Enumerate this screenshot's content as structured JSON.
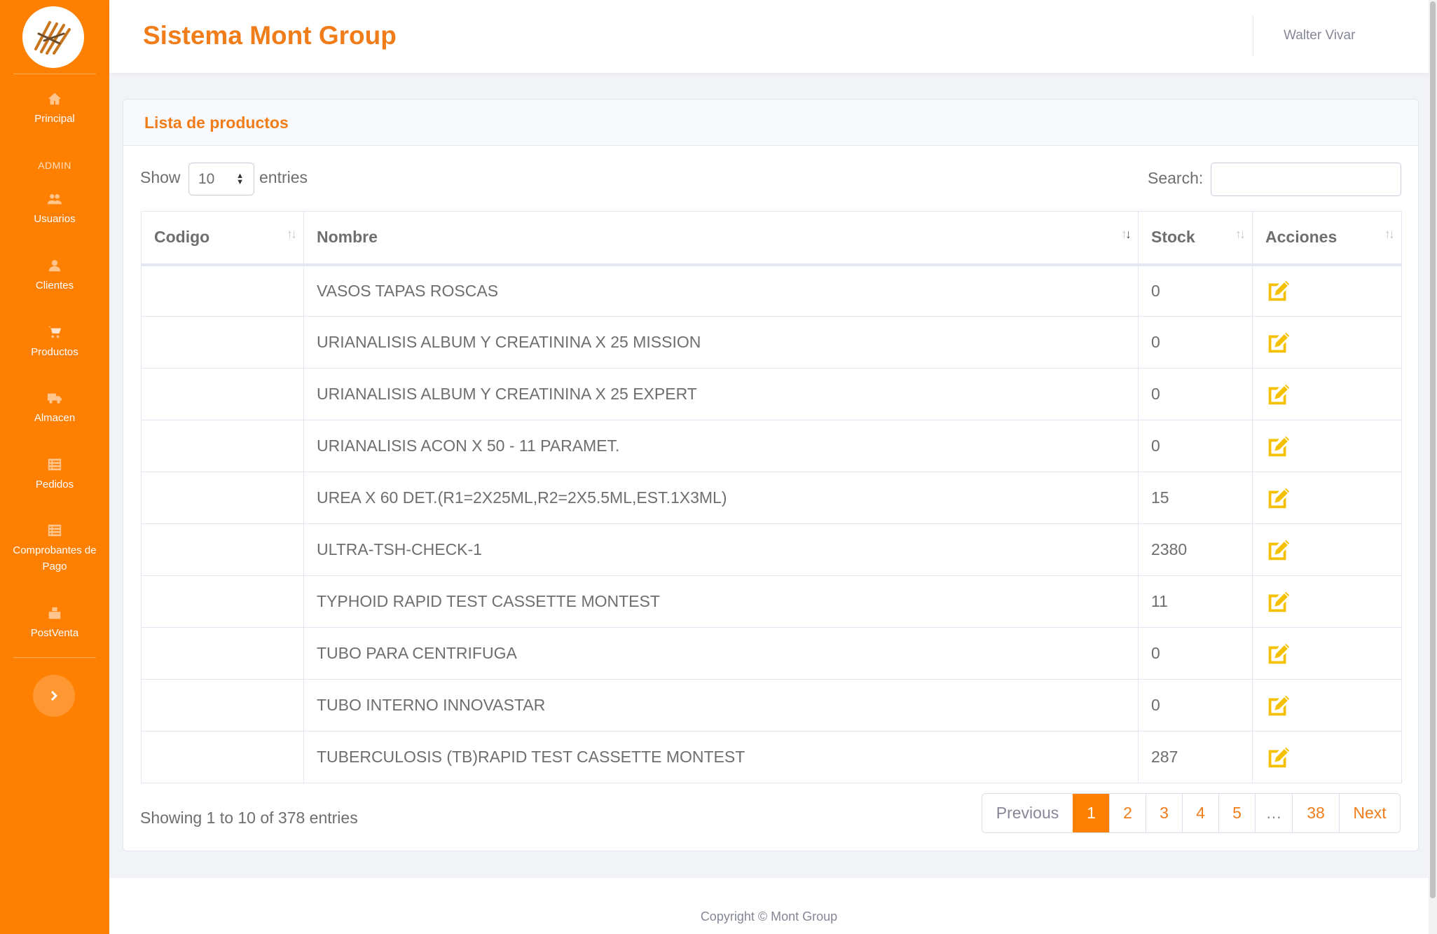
{
  "app": {
    "title": "Sistema Mont Group"
  },
  "user": {
    "name": "Walter Vivar"
  },
  "sidebar": {
    "admin_heading": "ADMIN",
    "items": [
      {
        "label": "Principal",
        "icon": "home-icon"
      },
      {
        "label": "Usuarios",
        "icon": "users-icon"
      },
      {
        "label": "Clientes",
        "icon": "user-icon"
      },
      {
        "label": "Productos",
        "icon": "cart-icon"
      },
      {
        "label": "Almacen",
        "icon": "truck-icon"
      },
      {
        "label": "Pedidos",
        "icon": "list-icon"
      },
      {
        "label": "Comprobantes de Pago",
        "icon": "list-icon"
      },
      {
        "label": "PostVenta",
        "icon": "box-icon"
      }
    ]
  },
  "card": {
    "title": "Lista de productos"
  },
  "controls": {
    "show_label": "Show",
    "entries_label": "entries",
    "page_size": "10",
    "search_label": "Search:",
    "search_value": ""
  },
  "table": {
    "columns": [
      "Codigo",
      "Nombre",
      "Stock",
      "Acciones"
    ],
    "sorted_column": "Nombre",
    "rows": [
      {
        "codigo": "",
        "nombre": "VASOS TAPAS ROSCAS",
        "stock": "0"
      },
      {
        "codigo": "",
        "nombre": "URIANALISIS ALBUM Y CREATININA X 25 MISSION",
        "stock": "0"
      },
      {
        "codigo": "",
        "nombre": "URIANALISIS ALBUM Y CREATININA X 25 EXPERT",
        "stock": "0"
      },
      {
        "codigo": "",
        "nombre": "URIANALISIS ACON X 50 - 11 PARAMET.",
        "stock": "0"
      },
      {
        "codigo": "",
        "nombre": "UREA X 60 DET.(R1=2X25ML,R2=2X5.5ML,EST.1X3ML)",
        "stock": "15"
      },
      {
        "codigo": "",
        "nombre": "ULTRA-TSH-CHECK-1",
        "stock": "2380"
      },
      {
        "codigo": "",
        "nombre": "TYPHOID RAPID TEST CASSETTE MONTEST",
        "stock": "11"
      },
      {
        "codigo": "",
        "nombre": "TUBO PARA CENTRIFUGA",
        "stock": "0"
      },
      {
        "codigo": "",
        "nombre": "TUBO INTERNO INNOVASTAR",
        "stock": "0"
      },
      {
        "codigo": "",
        "nombre": "TUBERCULOSIS (TB)RAPID TEST CASSETTE MONTEST",
        "stock": "287"
      }
    ]
  },
  "footer_info": "Showing 1 to 10 of 378 entries",
  "pagination": {
    "previous": "Previous",
    "pages": [
      "1",
      "2",
      "3",
      "4",
      "5",
      "…",
      "38"
    ],
    "active": "1",
    "next": "Next"
  },
  "copyright": "Copyright © Mont Group",
  "colors": {
    "brand": "#ff7f00",
    "title": "#f07d1a",
    "edit_icon": "#f5c000"
  }
}
